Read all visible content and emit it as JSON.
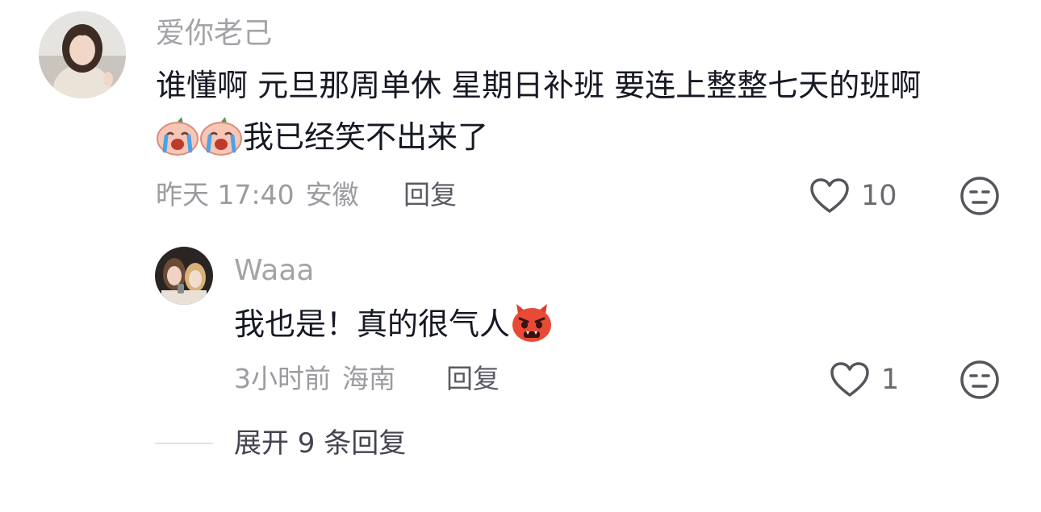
{
  "comment": {
    "username": "爱你老己",
    "text_line1": "谁懂啊 元旦那周单休 星期日补班 要连上整整七天的班啊",
    "text_line2": "我已经笑不出来了",
    "emoji": "crying-face-emoji",
    "time": "昨天 17:40",
    "location": "安徽",
    "reply_label": "回复",
    "like_count": "10"
  },
  "reply": {
    "username": "Waaa",
    "text": "我也是！真的很气人",
    "emoji": "angry-devil-emoji",
    "time": "3小时前",
    "location": "海南",
    "reply_label": "回复",
    "like_count": "1"
  },
  "expand_label": "展开 9 条回复",
  "colors": {
    "text": "#161823",
    "muted": "#9b9ba0",
    "icon": "#55555c"
  }
}
